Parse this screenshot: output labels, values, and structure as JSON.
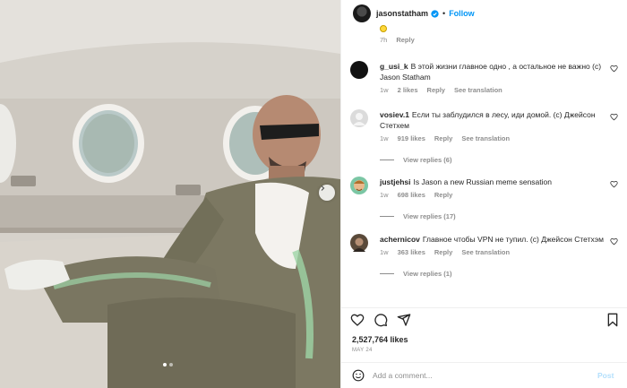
{
  "header": {
    "username": "jasonstatham",
    "separator": "•",
    "follow_label": "Follow"
  },
  "partial_reply": {
    "time": "7h",
    "reply_label": "Reply"
  },
  "comments": [
    {
      "username": "g_usi_k",
      "text": "В этой жизни главное одно , а остальное не важно (с) Jason Statham",
      "time": "1w",
      "likes": "2 likes",
      "reply_label": "Reply",
      "translation_label": "See translation",
      "avatar_color": "#111111"
    },
    {
      "username": "vosiev.1",
      "text": "Если ты заблудился в лесу, иди домой. (с) Джейсон Стетхем",
      "time": "1w",
      "likes": "919 likes",
      "reply_label": "Reply",
      "translation_label": "See translation",
      "view_replies": "View replies (6)",
      "avatar_color": "#dbdbdb"
    },
    {
      "username": "justjehsi",
      "text": "Is Jason a new Russian meme sensation",
      "time": "1w",
      "likes": "698 likes",
      "reply_label": "Reply",
      "view_replies": "View replies (17)",
      "avatar_color": "#7bc6a4"
    },
    {
      "username": "achernicov",
      "text": "Главное чтобы VPN не тупил. (с) Джейсон Стетхэм",
      "time": "1w",
      "likes": "363 likes",
      "reply_label": "Reply",
      "translation_label": "See translation",
      "view_replies": "View replies (1)",
      "avatar_color": "#5a4a3a"
    }
  ],
  "post": {
    "likes": "2,527,764 likes",
    "date": "MAY 24"
  },
  "add_comment": {
    "placeholder": "Add a comment...",
    "post_label": "Post"
  },
  "carousel": {
    "slide_count": 2,
    "active_slide": 1
  },
  "colors": {
    "accent": "#0095f6",
    "muted": "#8e8e8e",
    "post_disabled": "#b2dffc"
  },
  "icons": [
    "verified-badge-icon",
    "heart-icon",
    "comment-icon",
    "share-icon",
    "bookmark-icon",
    "emoji-icon",
    "chevron-right-icon"
  ]
}
